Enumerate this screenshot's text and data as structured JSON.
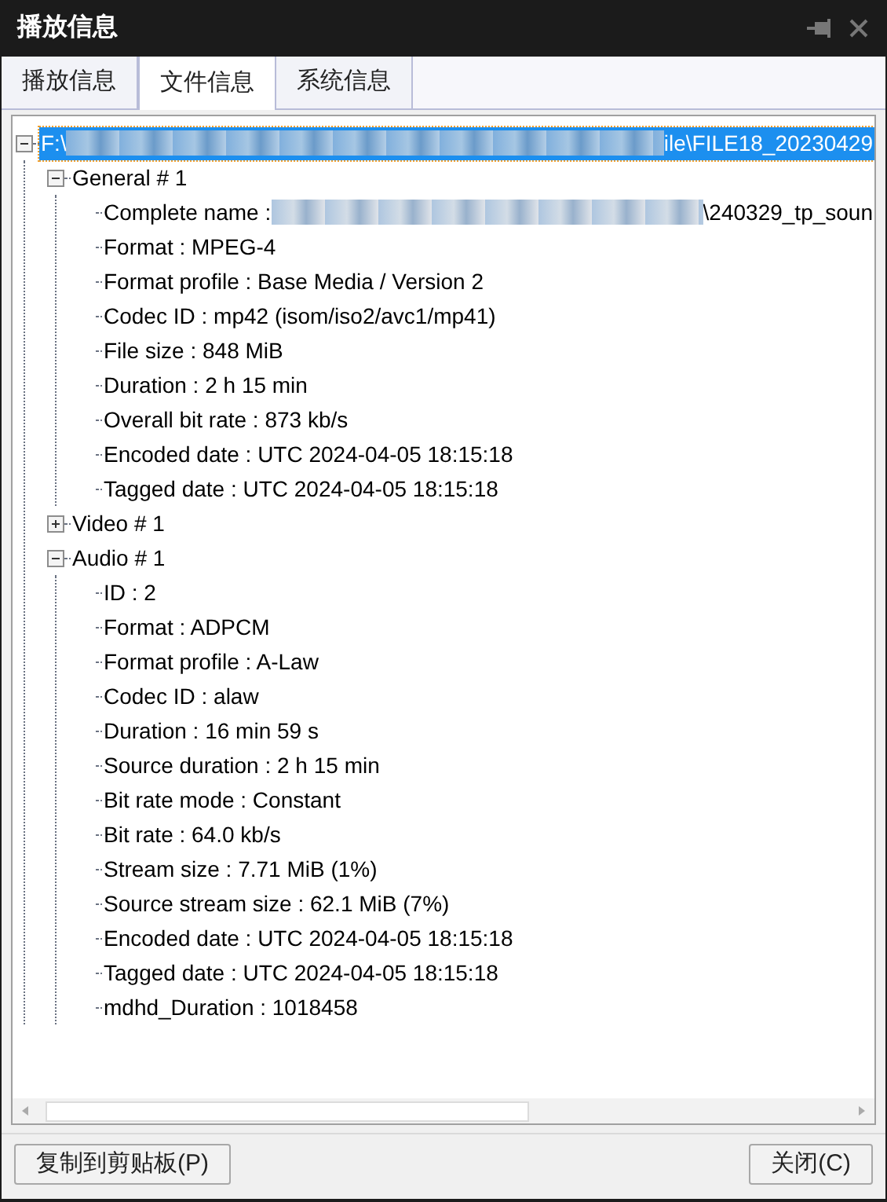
{
  "window": {
    "title": "播放信息"
  },
  "tabs": [
    {
      "label": "播放信息",
      "selected": false
    },
    {
      "label": "文件信息",
      "selected": true
    },
    {
      "label": "系统信息",
      "selected": false
    }
  ],
  "tree": [
    {
      "label": "F:\\",
      "label_tail": "ile\\FILE18_20230429",
      "redacted": true,
      "expanded": true,
      "selected": true,
      "children": [
        {
          "label": "General # 1",
          "expanded": true,
          "selected": false,
          "children": [
            {
              "label": "Complete name : ",
              "label_tail": "\\240329_tp_soun",
              "redacted": true,
              "selected": false
            },
            {
              "label": "Format : MPEG-4",
              "selected": false
            },
            {
              "label": "Format profile : Base Media / Version 2",
              "selected": false
            },
            {
              "label": "Codec ID : mp42 (isom/iso2/avc1/mp41)",
              "selected": false
            },
            {
              "label": "File size : 848 MiB",
              "selected": false
            },
            {
              "label": "Duration : 2 h 15 min",
              "selected": false
            },
            {
              "label": "Overall bit rate : 873 kb/s",
              "selected": false
            },
            {
              "label": "Encoded date : UTC 2024-04-05 18:15:18",
              "selected": false
            },
            {
              "label": "Tagged date : UTC 2024-04-05 18:15:18",
              "selected": false
            }
          ]
        },
        {
          "label": "Video # 1",
          "expanded": false,
          "selected": false
        },
        {
          "label": "Audio # 1",
          "expanded": true,
          "selected": false,
          "children": [
            {
              "label": "ID : 2",
              "selected": false
            },
            {
              "label": "Format : ADPCM",
              "selected": false
            },
            {
              "label": "Format profile : A-Law",
              "selected": false
            },
            {
              "label": "Codec ID : alaw",
              "selected": false
            },
            {
              "label": "Duration : 16 min 59 s",
              "selected": false
            },
            {
              "label": "Source duration : 2 h 15 min",
              "selected": false
            },
            {
              "label": "Bit rate mode : Constant",
              "selected": false
            },
            {
              "label": "Bit rate : 64.0 kb/s",
              "selected": false
            },
            {
              "label": "Stream size : 7.71 MiB (1%)",
              "selected": false
            },
            {
              "label": "Source stream size : 62.1 MiB (7%)",
              "selected": false
            },
            {
              "label": "Encoded date : UTC 2024-04-05 18:15:18",
              "selected": false
            },
            {
              "label": "Tagged date : UTC 2024-04-05 18:15:18",
              "selected": false
            },
            {
              "label": "mdhd_Duration : 1018458",
              "selected": false
            }
          ]
        }
      ]
    }
  ],
  "buttons": [
    "复制到剪贴板(P)",
    "关闭(C)"
  ]
}
